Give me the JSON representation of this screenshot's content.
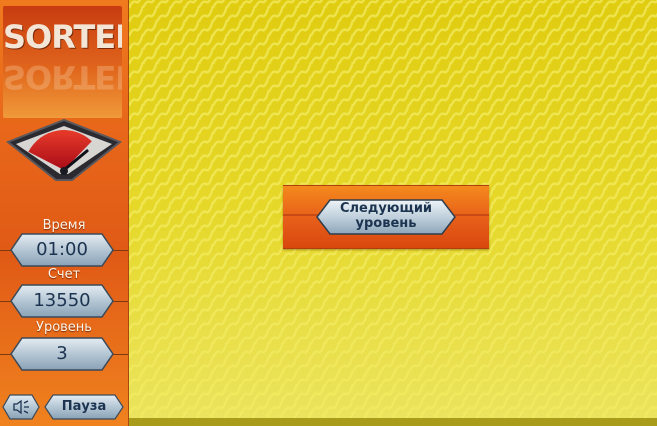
{
  "app": {
    "logo_text": "SORTER"
  },
  "stats": {
    "time_label": "Время",
    "time_value": "01:00",
    "score_label": "Счет",
    "score_value": "13550",
    "level_label": "Уровень",
    "level_value": "3"
  },
  "gauge": {
    "level_fraction": 0.85,
    "icon": "speedometer-gauge-icon"
  },
  "controls": {
    "sound_icon": "speaker-icon",
    "pause_label": "Пауза"
  },
  "dialog": {
    "next_level_line1": "Следующий",
    "next_level_line2": "уровень"
  },
  "colors": {
    "sidebar_orange": "#e8671a",
    "playfield_yellow": "#e6d52a",
    "pill_blue": "#b8cad8",
    "text_navy": "#1c3450",
    "gauge_red": "#c8102e"
  }
}
